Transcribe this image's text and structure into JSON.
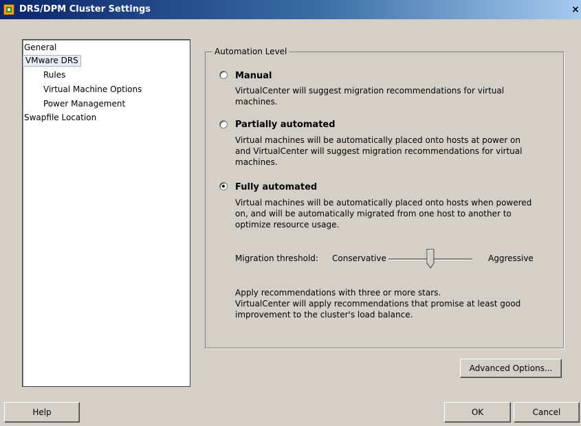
{
  "window": {
    "title": "DRS/DPM Cluster Settings",
    "close_glyph": "×"
  },
  "nav": {
    "items": [
      {
        "label": "General"
      },
      {
        "label": "VMware DRS",
        "selected": true
      },
      {
        "label": "Rules"
      },
      {
        "label": "Virtual Machine Options"
      },
      {
        "label": "Power Management"
      },
      {
        "label": "Swapfile Location"
      }
    ]
  },
  "automation": {
    "legend": "Automation Level",
    "options": [
      {
        "title": "Manual",
        "desc": "VirtualCenter will suggest migration recommendations for virtual machines.",
        "checked": false
      },
      {
        "title": "Partially automated",
        "desc": "Virtual machines will be automatically placed onto hosts at power on and VirtualCenter will suggest migration recommendations for virtual machines.",
        "checked": false
      },
      {
        "title": "Fully automated",
        "desc": "Virtual machines will be automatically placed onto hosts when powered on, and will be automatically migrated from one host to another to optimize resource usage.",
        "checked": true
      }
    ],
    "threshold": {
      "label": "Migration threshold:",
      "min_label": "Conservative",
      "max_label": "Aggressive",
      "level": 0.5
    },
    "recommendation": "Apply recommendations with three or more stars.",
    "recommendation_detail": "VirtualCenter will apply recommendations that promise at least good improvement to the cluster's load balance."
  },
  "buttons": {
    "advanced": "Advanced Options...",
    "help": "Help",
    "ok": "OK",
    "cancel": "Cancel"
  }
}
